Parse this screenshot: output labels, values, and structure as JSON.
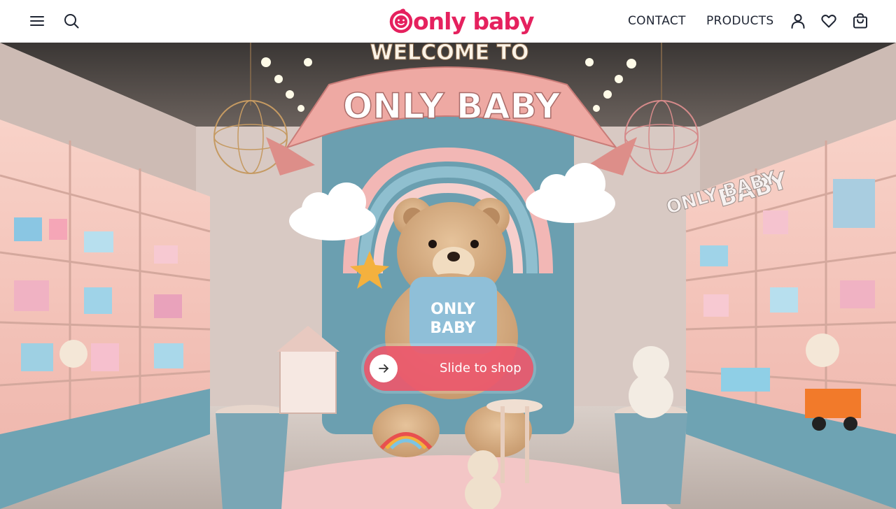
{
  "brand": {
    "logo_text": "only baby",
    "accent_color": "#e5215e"
  },
  "header": {
    "menu_icon": "hamburger-menu-icon",
    "search_icon": "search-icon",
    "nav": [
      {
        "label": "CONTACT"
      },
      {
        "label": "PRODUCTS"
      }
    ],
    "account_icon": "user-icon",
    "wishlist_icon": "heart-icon",
    "cart_icon": "shopping-bag-icon"
  },
  "hero": {
    "signs": {
      "welcome": "WELCOME TO",
      "banner": "ONLY BABY",
      "wall_left": "ONLY BABY",
      "wall_right": "BABY",
      "bear_shirt_line1": "ONLY",
      "bear_shirt_line2": "BABY"
    },
    "slide_button": {
      "label": "Slide to shop",
      "knob_icon": "arrow-right-icon",
      "color": "#ec586c"
    }
  }
}
